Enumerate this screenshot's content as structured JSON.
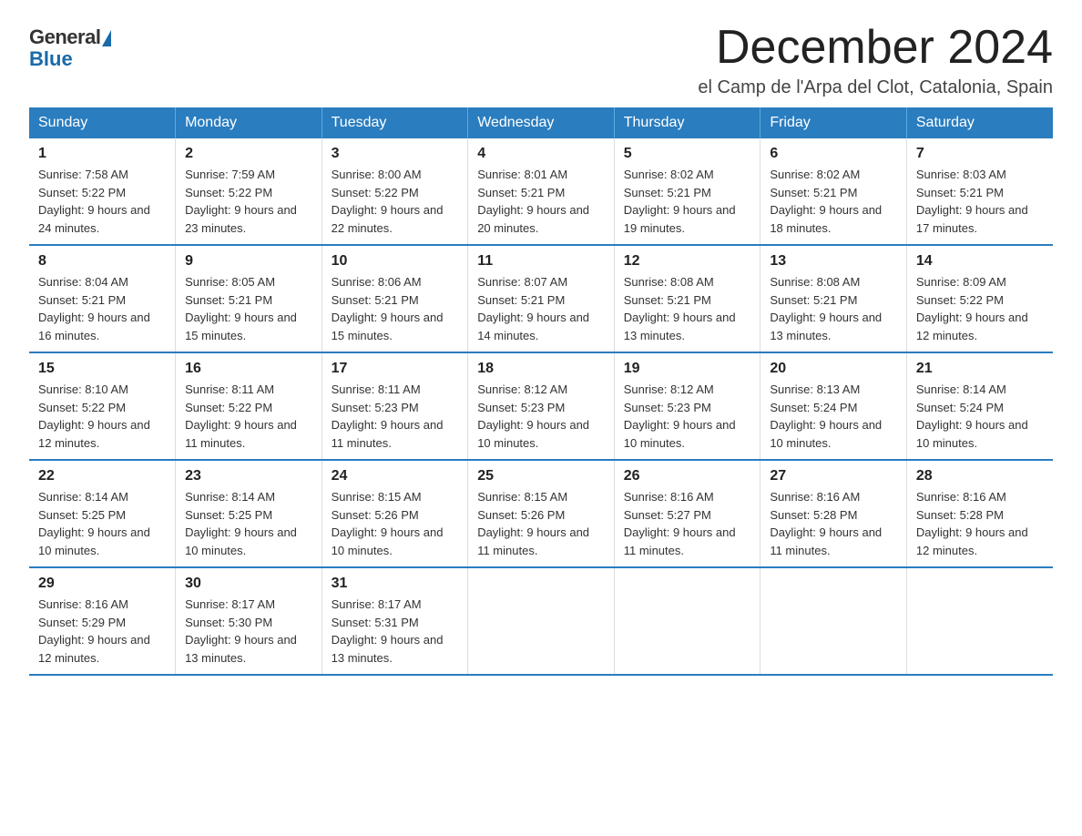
{
  "logo": {
    "general_text": "General",
    "blue_text": "Blue"
  },
  "header": {
    "month_year": "December 2024",
    "location": "el Camp de l'Arpa del Clot, Catalonia, Spain"
  },
  "weekdays": [
    "Sunday",
    "Monday",
    "Tuesday",
    "Wednesday",
    "Thursday",
    "Friday",
    "Saturday"
  ],
  "weeks": [
    [
      {
        "day": "1",
        "sunrise": "7:58 AM",
        "sunset": "5:22 PM",
        "daylight": "9 hours and 24 minutes."
      },
      {
        "day": "2",
        "sunrise": "7:59 AM",
        "sunset": "5:22 PM",
        "daylight": "9 hours and 23 minutes."
      },
      {
        "day": "3",
        "sunrise": "8:00 AM",
        "sunset": "5:22 PM",
        "daylight": "9 hours and 22 minutes."
      },
      {
        "day": "4",
        "sunrise": "8:01 AM",
        "sunset": "5:21 PM",
        "daylight": "9 hours and 20 minutes."
      },
      {
        "day": "5",
        "sunrise": "8:02 AM",
        "sunset": "5:21 PM",
        "daylight": "9 hours and 19 minutes."
      },
      {
        "day": "6",
        "sunrise": "8:02 AM",
        "sunset": "5:21 PM",
        "daylight": "9 hours and 18 minutes."
      },
      {
        "day": "7",
        "sunrise": "8:03 AM",
        "sunset": "5:21 PM",
        "daylight": "9 hours and 17 minutes."
      }
    ],
    [
      {
        "day": "8",
        "sunrise": "8:04 AM",
        "sunset": "5:21 PM",
        "daylight": "9 hours and 16 minutes."
      },
      {
        "day": "9",
        "sunrise": "8:05 AM",
        "sunset": "5:21 PM",
        "daylight": "9 hours and 15 minutes."
      },
      {
        "day": "10",
        "sunrise": "8:06 AM",
        "sunset": "5:21 PM",
        "daylight": "9 hours and 15 minutes."
      },
      {
        "day": "11",
        "sunrise": "8:07 AM",
        "sunset": "5:21 PM",
        "daylight": "9 hours and 14 minutes."
      },
      {
        "day": "12",
        "sunrise": "8:08 AM",
        "sunset": "5:21 PM",
        "daylight": "9 hours and 13 minutes."
      },
      {
        "day": "13",
        "sunrise": "8:08 AM",
        "sunset": "5:21 PM",
        "daylight": "9 hours and 13 minutes."
      },
      {
        "day": "14",
        "sunrise": "8:09 AM",
        "sunset": "5:22 PM",
        "daylight": "9 hours and 12 minutes."
      }
    ],
    [
      {
        "day": "15",
        "sunrise": "8:10 AM",
        "sunset": "5:22 PM",
        "daylight": "9 hours and 12 minutes."
      },
      {
        "day": "16",
        "sunrise": "8:11 AM",
        "sunset": "5:22 PM",
        "daylight": "9 hours and 11 minutes."
      },
      {
        "day": "17",
        "sunrise": "8:11 AM",
        "sunset": "5:23 PM",
        "daylight": "9 hours and 11 minutes."
      },
      {
        "day": "18",
        "sunrise": "8:12 AM",
        "sunset": "5:23 PM",
        "daylight": "9 hours and 10 minutes."
      },
      {
        "day": "19",
        "sunrise": "8:12 AM",
        "sunset": "5:23 PM",
        "daylight": "9 hours and 10 minutes."
      },
      {
        "day": "20",
        "sunrise": "8:13 AM",
        "sunset": "5:24 PM",
        "daylight": "9 hours and 10 minutes."
      },
      {
        "day": "21",
        "sunrise": "8:14 AM",
        "sunset": "5:24 PM",
        "daylight": "9 hours and 10 minutes."
      }
    ],
    [
      {
        "day": "22",
        "sunrise": "8:14 AM",
        "sunset": "5:25 PM",
        "daylight": "9 hours and 10 minutes."
      },
      {
        "day": "23",
        "sunrise": "8:14 AM",
        "sunset": "5:25 PM",
        "daylight": "9 hours and 10 minutes."
      },
      {
        "day": "24",
        "sunrise": "8:15 AM",
        "sunset": "5:26 PM",
        "daylight": "9 hours and 10 minutes."
      },
      {
        "day": "25",
        "sunrise": "8:15 AM",
        "sunset": "5:26 PM",
        "daylight": "9 hours and 11 minutes."
      },
      {
        "day": "26",
        "sunrise": "8:16 AM",
        "sunset": "5:27 PM",
        "daylight": "9 hours and 11 minutes."
      },
      {
        "day": "27",
        "sunrise": "8:16 AM",
        "sunset": "5:28 PM",
        "daylight": "9 hours and 11 minutes."
      },
      {
        "day": "28",
        "sunrise": "8:16 AM",
        "sunset": "5:28 PM",
        "daylight": "9 hours and 12 minutes."
      }
    ],
    [
      {
        "day": "29",
        "sunrise": "8:16 AM",
        "sunset": "5:29 PM",
        "daylight": "9 hours and 12 minutes."
      },
      {
        "day": "30",
        "sunrise": "8:17 AM",
        "sunset": "5:30 PM",
        "daylight": "9 hours and 13 minutes."
      },
      {
        "day": "31",
        "sunrise": "8:17 AM",
        "sunset": "5:31 PM",
        "daylight": "9 hours and 13 minutes."
      },
      null,
      null,
      null,
      null
    ]
  ],
  "colors": {
    "header_bg": "#2a7dbf",
    "header_text": "#ffffff",
    "border": "#2a7dbf"
  }
}
